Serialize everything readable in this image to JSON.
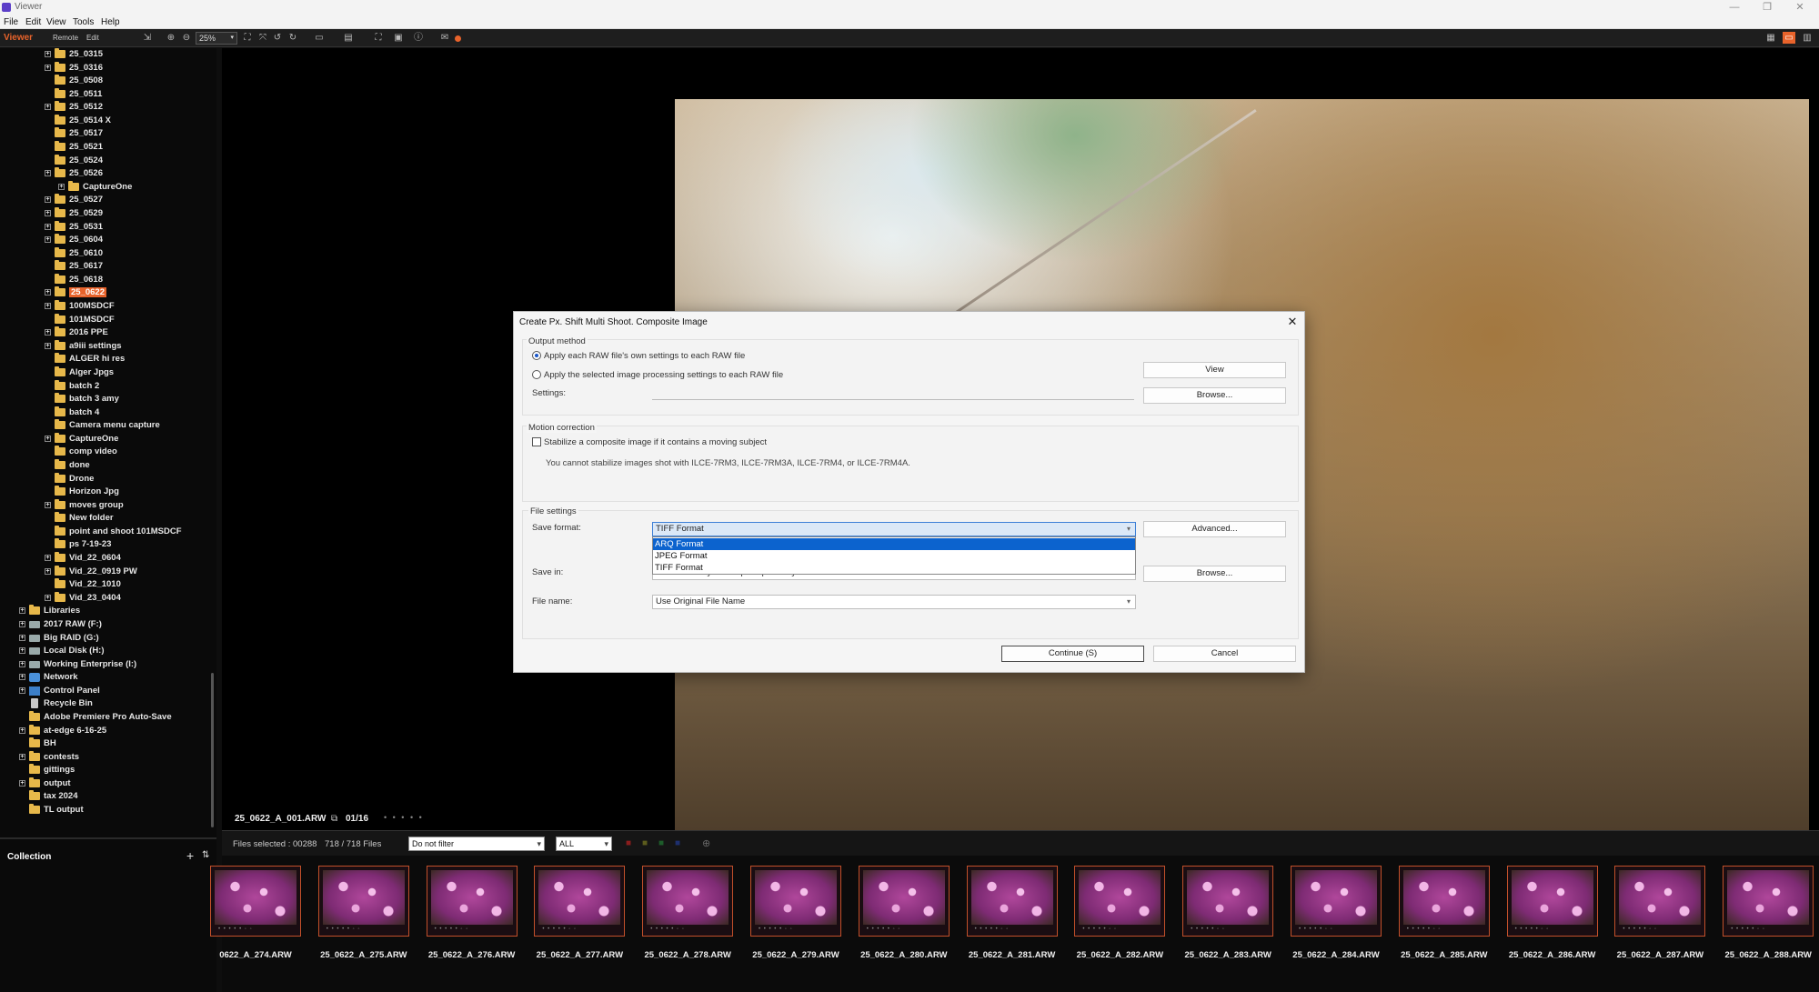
{
  "window": {
    "title": "Viewer"
  },
  "menu": [
    "File",
    "Edit",
    "View",
    "Tools",
    "Help"
  ],
  "toolbar": {
    "mode": "Viewer",
    "remote": "Remote",
    "edit": "Edit",
    "zoom": "25%"
  },
  "tree": {
    "selected": "25_0622",
    "items": [
      {
        "label": "25_0315",
        "level": 1,
        "expand": true
      },
      {
        "label": "25_0316",
        "level": 1,
        "expand": true
      },
      {
        "label": "25_0508",
        "level": 1,
        "expand": false
      },
      {
        "label": "25_0511",
        "level": 1,
        "expand": false
      },
      {
        "label": "25_0512",
        "level": 1,
        "expand": true
      },
      {
        "label": "25_0514 X",
        "level": 1,
        "expand": false
      },
      {
        "label": "25_0517",
        "level": 1,
        "expand": false
      },
      {
        "label": "25_0521",
        "level": 1,
        "expand": false
      },
      {
        "label": "25_0524",
        "level": 1,
        "expand": false
      },
      {
        "label": "25_0526",
        "level": 1,
        "expand": true
      },
      {
        "label": "CaptureOne",
        "level": 2,
        "expand": true
      },
      {
        "label": "25_0527",
        "level": 1,
        "expand": true
      },
      {
        "label": "25_0529",
        "level": 1,
        "expand": true
      },
      {
        "label": "25_0531",
        "level": 1,
        "expand": true
      },
      {
        "label": "25_0604",
        "level": 1,
        "expand": true
      },
      {
        "label": "25_0610",
        "level": 1,
        "expand": false
      },
      {
        "label": "25_0617",
        "level": 1,
        "expand": false
      },
      {
        "label": "25_0618",
        "level": 1,
        "expand": false
      },
      {
        "label": "25_0622",
        "level": 1,
        "expand": true
      },
      {
        "label": "100MSDCF",
        "level": 1,
        "expand": true
      },
      {
        "label": "101MSDCF",
        "level": 1,
        "expand": false
      },
      {
        "label": "2016 PPE",
        "level": 1,
        "expand": true
      },
      {
        "label": "a9iii settings",
        "level": 1,
        "expand": true
      },
      {
        "label": "ALGER hi res",
        "level": 1,
        "expand": false
      },
      {
        "label": "Alger Jpgs",
        "level": 1,
        "expand": false
      },
      {
        "label": "batch 2",
        "level": 1,
        "expand": false
      },
      {
        "label": "batch 3 amy",
        "level": 1,
        "expand": false
      },
      {
        "label": "batch 4",
        "level": 1,
        "expand": false
      },
      {
        "label": "Camera menu capture",
        "level": 1,
        "expand": false
      },
      {
        "label": "CaptureOne",
        "level": 1,
        "expand": true
      },
      {
        "label": "comp video",
        "level": 1,
        "expand": false
      },
      {
        "label": "done",
        "level": 1,
        "expand": false
      },
      {
        "label": "Drone",
        "level": 1,
        "expand": false
      },
      {
        "label": "Horizon Jpg",
        "level": 1,
        "expand": false
      },
      {
        "label": "moves group",
        "level": 1,
        "expand": true
      },
      {
        "label": "New folder",
        "level": 1,
        "expand": false
      },
      {
        "label": "point and shoot 101MSDCF",
        "level": 1,
        "expand": false
      },
      {
        "label": "ps 7-19-23",
        "level": 1,
        "expand": false
      },
      {
        "label": "Vid_22_0604",
        "level": 1,
        "expand": true
      },
      {
        "label": "Vid_22_0919 PW",
        "level": 1,
        "expand": true
      },
      {
        "label": "Vid_22_1010",
        "level": 1,
        "expand": false
      },
      {
        "label": "Vid_23_0404",
        "level": 1,
        "expand": true
      },
      {
        "label": "Libraries",
        "level": 0,
        "expand": true,
        "icon": "folder"
      },
      {
        "label": "2017 RAW (F:)",
        "level": 0,
        "expand": true,
        "icon": "drive"
      },
      {
        "label": "Big RAID (G:)",
        "level": 0,
        "expand": true,
        "icon": "drive"
      },
      {
        "label": "Local Disk (H:)",
        "level": 0,
        "expand": true,
        "icon": "drive"
      },
      {
        "label": "Working Enterprise (I:)",
        "level": 0,
        "expand": true,
        "icon": "drive"
      },
      {
        "label": "Network",
        "level": 0,
        "expand": true,
        "icon": "network"
      },
      {
        "label": "Control Panel",
        "level": 0,
        "expand": true,
        "icon": "control-panel"
      },
      {
        "label": "Recycle Bin",
        "level": 0,
        "expand": false,
        "icon": "recycle-bin"
      },
      {
        "label": "Adobe Premiere Pro Auto-Save",
        "level": 0,
        "expand": false,
        "icon": "folder"
      },
      {
        "label": "at-edge 6-16-25",
        "level": 0,
        "expand": true,
        "icon": "folder"
      },
      {
        "label": "BH",
        "level": 0,
        "expand": false,
        "icon": "folder"
      },
      {
        "label": "contests",
        "level": 0,
        "expand": true,
        "icon": "folder"
      },
      {
        "label": "gittings",
        "level": 0,
        "expand": false,
        "icon": "folder"
      },
      {
        "label": "output",
        "level": 0,
        "expand": true,
        "icon": "folder"
      },
      {
        "label": "tax 2024",
        "level": 0,
        "expand": false,
        "icon": "folder"
      },
      {
        "label": "TL output",
        "level": 0,
        "expand": false,
        "icon": "folder"
      }
    ]
  },
  "collection": {
    "title": "Collection"
  },
  "viewer": {
    "filename": "25_0622_A_001.ARW",
    "index": "01/16",
    "dots": "• • • • •"
  },
  "filmbar": {
    "files_selected": "Files selected : 00288",
    "file_count": "718 / 718 Files",
    "filter": "Do not filter",
    "scope": "ALL"
  },
  "filmstrip": [
    "0622_A_274.ARW",
    "25_0622_A_275.ARW",
    "25_0622_A_276.ARW",
    "25_0622_A_277.ARW",
    "25_0622_A_278.ARW",
    "25_0622_A_279.ARW",
    "25_0622_A_280.ARW",
    "25_0622_A_281.ARW",
    "25_0622_A_282.ARW",
    "25_0622_A_283.ARW",
    "25_0622_A_284.ARW",
    "25_0622_A_285.ARW",
    "25_0622_A_286.ARW",
    "25_0622_A_287.ARW",
    "25_0622_A_288.ARW"
  ],
  "dialog": {
    "title": "Create Px. Shift Multi Shoot. Composite Image",
    "output_method": {
      "label": "Output method",
      "option1": "Apply each RAW file's own settings to each RAW file",
      "option2": "Apply the selected image processing settings to each RAW file",
      "settings_label": "Settings:",
      "view_button": "View",
      "browse_button": "Browse..."
    },
    "motion": {
      "label": "Motion correction",
      "checkbox": "Stabilize a composite image if it contains a moving subject",
      "note": "You cannot stabilize images shot with ILCE-7RM3, ILCE-7RM3A, ILCE-7RM4, or ILCE-7RM4A."
    },
    "file_settings": {
      "label": "File settings",
      "save_format_label": "Save format:",
      "save_format_value": "TIFF Format",
      "format_options": [
        "ARQ Format",
        "JPEG Format",
        "TIFF Format"
      ],
      "advanced_button": "Advanced...",
      "save_in_label": "Save in:",
      "save_in_value": "C:\\Users\\Sony\\Desktop\\Output\\Sony",
      "browse_button": "Browse...",
      "file_name_label": "File name:",
      "file_name_value": "Use Original File Name"
    },
    "continue_button": "Continue (S)",
    "cancel_button": "Cancel"
  }
}
